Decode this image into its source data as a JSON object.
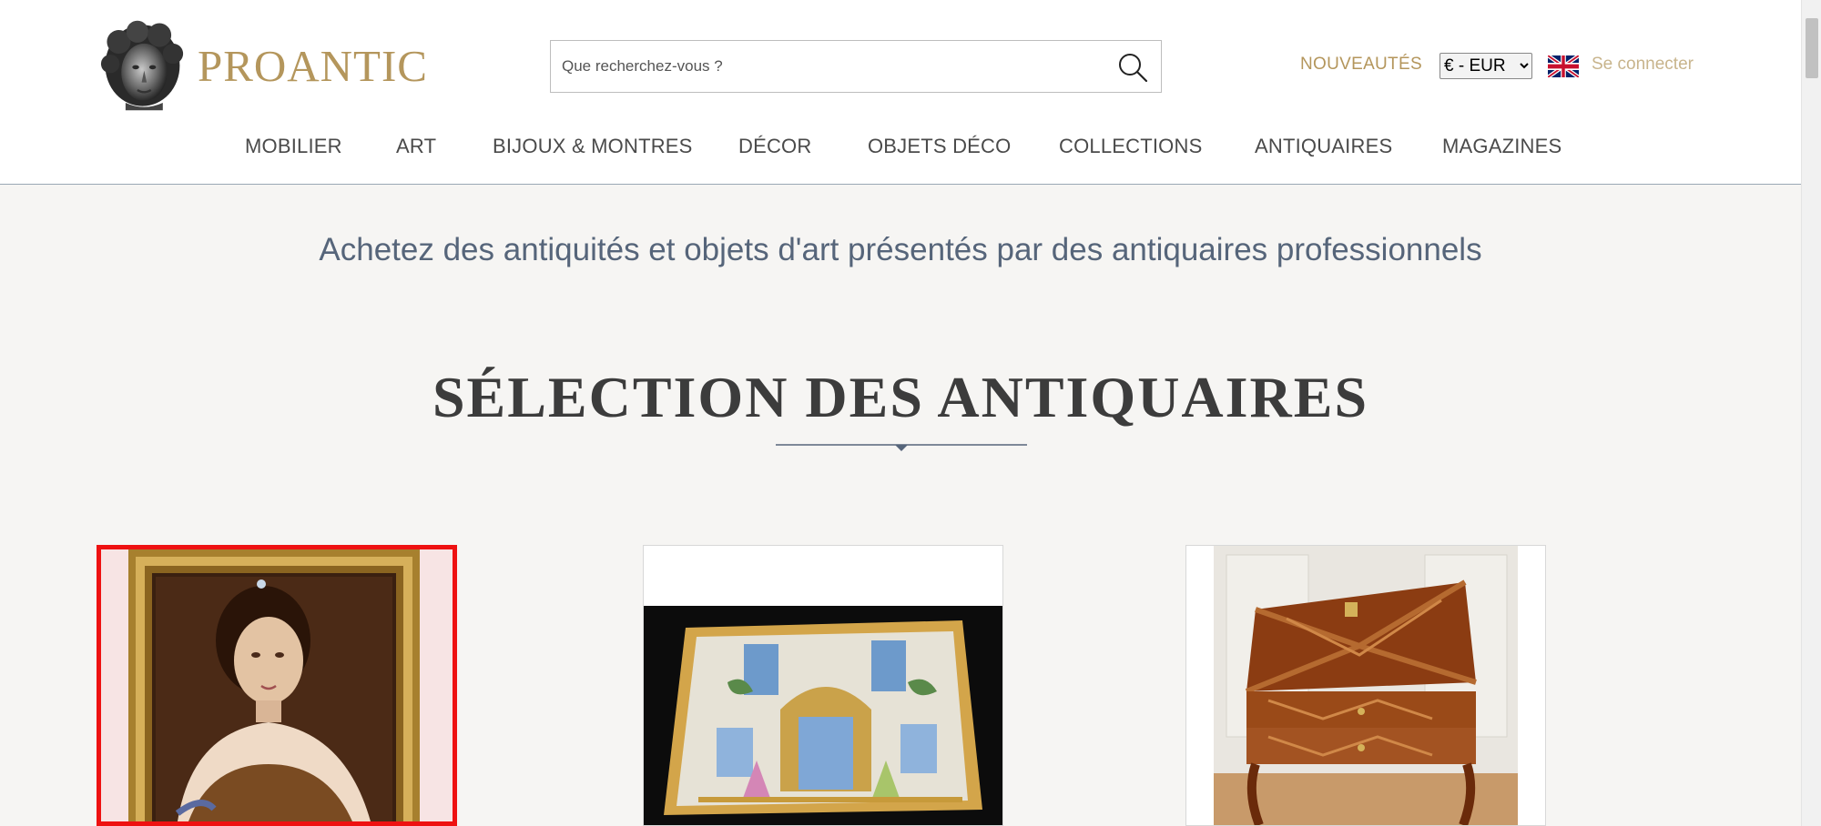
{
  "header": {
    "logo_text": "PROANTIC",
    "search_placeholder": "Que recherchez-vous ?",
    "nouveautes": "NOUVEAUTÉS",
    "currency": "€ - EUR",
    "currency_options": [
      "€ - EUR"
    ],
    "signin": "Se connecter",
    "brand_color": "#b4965c"
  },
  "nav": {
    "items": [
      {
        "label": "MOBILIER"
      },
      {
        "label": "ART"
      },
      {
        "label": "BIJOUX & MONTRES"
      },
      {
        "label": "DÉCOR"
      },
      {
        "label": "OBJETS DÉCO"
      },
      {
        "label": "COLLECTIONS"
      },
      {
        "label": "ANTIQUAIRES"
      },
      {
        "label": "MAGAZINES"
      }
    ]
  },
  "main": {
    "tagline": "Achetez des antiquités et objets d'art présentés par des antiquaires professionnels",
    "section_title": "SÉLECTION DES ANTIQUAIRES",
    "products": [
      {
        "image": "portrait-painting",
        "selected": true
      },
      {
        "image": "beaded-tapestry",
        "selected": false
      },
      {
        "image": "marquetry-writing-desk",
        "selected": false
      }
    ]
  },
  "icons": {
    "search": "search-icon",
    "flag": "uk-flag-icon",
    "logo": "sculpted-head-logo"
  }
}
